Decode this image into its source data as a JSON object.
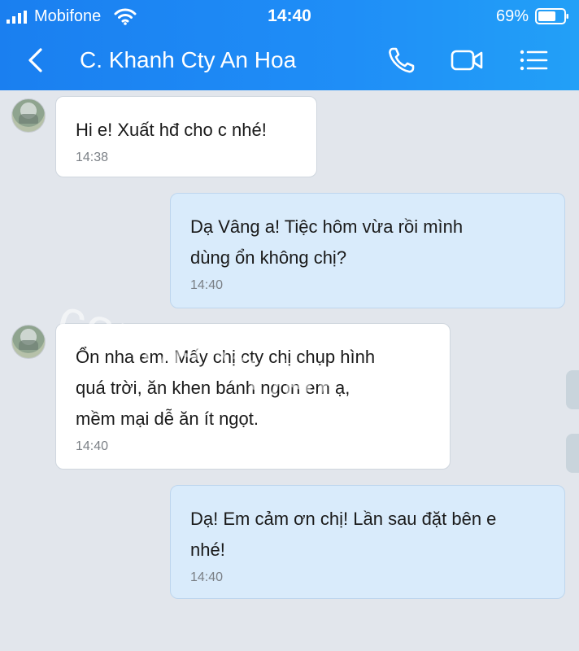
{
  "status_bar": {
    "carrier": "Mobifone",
    "time": "14:40",
    "battery": "69%"
  },
  "header": {
    "title": "C. Khanh Cty An Hoa",
    "back_icon": "chevron-left-icon",
    "call_icon": "phone-icon",
    "video_icon": "video-camera-icon",
    "menu_icon": "list-menu-icon"
  },
  "watermark": "connectviet.vn",
  "messages": [
    {
      "direction": "in",
      "text": "Hi e! Xuất hđ cho c nhé!",
      "time": "14:38"
    },
    {
      "direction": "out",
      "text": "Dạ Vâng a! Tiệc hôm vừa rồi mình\ndùng ổn không chị?",
      "time": "14:40"
    },
    {
      "direction": "in",
      "text": "Ổn nha em. Mấy chị cty chị chụp hình\nquá trời, ăn khen bánh ngon em ạ,\nmềm mại dễ ăn ít ngọt.",
      "time": "14:40"
    },
    {
      "direction": "out",
      "text": "Dạ! Em cảm ơn chị! Lần sau đặt bên e\nnhé!",
      "time": "14:40"
    }
  ],
  "colors": {
    "header_blue": "#1f8ef7",
    "outgoing_bubble": "#d9ebfb",
    "incoming_bubble": "#ffffff",
    "background": "#e2e6ec"
  }
}
